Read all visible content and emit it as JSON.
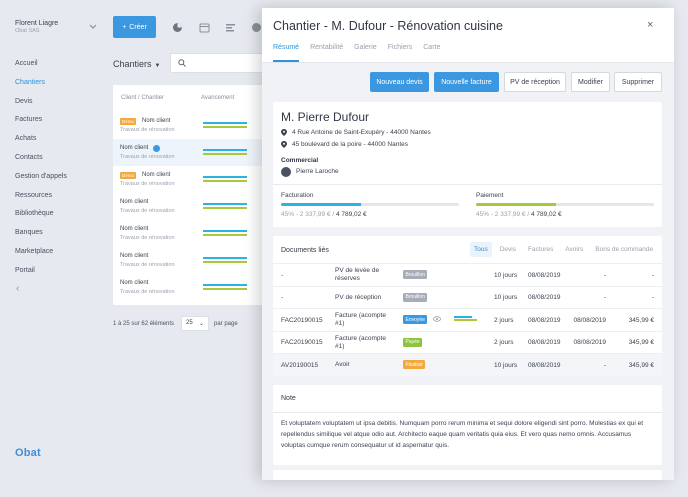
{
  "company": {
    "name": "Florent Liagre",
    "sub": "Obat SAS"
  },
  "toolbar": {
    "create_label": "Créer"
  },
  "sidebar": {
    "items": [
      {
        "label": "Accueil",
        "active": false
      },
      {
        "label": "Chantiers",
        "active": true
      },
      {
        "label": "Devis",
        "active": false
      },
      {
        "label": "Factures",
        "active": false
      },
      {
        "label": "Achats",
        "active": false
      },
      {
        "label": "Contacts",
        "active": false
      },
      {
        "label": "Gestion d'appels",
        "active": false
      },
      {
        "label": "Ressources",
        "active": false
      },
      {
        "label": "Bibliothèque",
        "active": false
      },
      {
        "label": "Banques",
        "active": false
      },
      {
        "label": "Marketplace",
        "active": false
      },
      {
        "label": "Portail",
        "active": false
      }
    ],
    "back_glyph": "‹",
    "logo": "Obat"
  },
  "list": {
    "title": "Chantiers",
    "columns": {
      "client": "Client / Chantier",
      "progress": "Avancement"
    },
    "rows": [
      {
        "badge": "Démo",
        "name": "Nom client",
        "sub": "Travaux de rénovation"
      },
      {
        "badge": "",
        "name": "Nom client",
        "sub": "Travaux de rénovation"
      },
      {
        "badge": "Démo",
        "name": "Nom client",
        "sub": "Travaux de rénovation"
      },
      {
        "badge": "",
        "name": "Nom client",
        "sub": "Travaux de rénovation"
      },
      {
        "badge": "",
        "name": "Nom client",
        "sub": "Travaux de rénovation"
      },
      {
        "badge": "",
        "name": "Nom client",
        "sub": "Travaux de rénovation"
      },
      {
        "badge": "",
        "name": "Nom client",
        "sub": "Travaux de rénovation"
      }
    ],
    "pager_text": "1 à 25 sur 62 éléments",
    "page_size": "25",
    "page_size_suffix": "par page"
  },
  "drawer": {
    "title": "Chantier - M. Dufour - Rénovation cuisine",
    "close_glyph": "×",
    "tabs": [
      {
        "label": "Résumé",
        "active": true
      },
      {
        "label": "Rentabilité",
        "active": false
      },
      {
        "label": "Galerie",
        "active": false
      },
      {
        "label": "Fichiers",
        "active": false
      },
      {
        "label": "Carte",
        "active": false
      }
    ],
    "actions": {
      "new_quote": "Nouveau devis",
      "new_invoice": "Nouvelle facture",
      "pv": "PV de réception",
      "edit": "Modifier",
      "delete": "Supprimer"
    },
    "client": {
      "name": "M. Pierre Dufour",
      "address1": "4 Rue Antoine de Saint-Exupéry - 44000 Nantes",
      "address2": "45 boulevard de la poire - 44000 Nantes",
      "commercial_label": "Commercial",
      "commercial_name": "Pierre Laroche"
    },
    "billing": {
      "label": "Facturation",
      "percent": 45,
      "percent_text": "45%",
      "amount": "2 337,99 €",
      "total": "4 789,02 €",
      "color": "#2db3e3"
    },
    "payment": {
      "label": "Paiement",
      "percent": 45,
      "percent_text": "45%",
      "amount": "2 337,99 €",
      "total": "4 789,02 €",
      "color": "#a8c93c"
    },
    "documents": {
      "title": "Documents liés",
      "filters": [
        {
          "label": "Tous",
          "active": true
        },
        {
          "label": "Devis",
          "active": false
        },
        {
          "label": "Factures",
          "active": false
        },
        {
          "label": "Avoirs",
          "active": false
        },
        {
          "label": "Bons de commande",
          "active": false
        }
      ],
      "rows": [
        {
          "ref": "-",
          "type": "PV de levée de réserves",
          "status": "Brouillon",
          "status_color": "#a7adb7",
          "delay": "10 jours",
          "date": "08/08/2019",
          "date2": "-",
          "amount": "-",
          "eye": false,
          "bars": false,
          "highlight": false
        },
        {
          "ref": "-",
          "type": "PV de réception",
          "status": "Brouillon",
          "status_color": "#a7adb7",
          "delay": "10 jours",
          "date": "08/08/2019",
          "date2": "-",
          "amount": "-",
          "eye": false,
          "bars": false,
          "highlight": false
        },
        {
          "ref": "FAC20190015",
          "type": "Facture (acompte #1)",
          "status": "Envoyée",
          "status_color": "#3b98e0",
          "delay": "2 jours",
          "date": "08/08/2019",
          "date2": "08/08/2019",
          "amount": "345,99 €",
          "eye": true,
          "bars": true,
          "highlight": false
        },
        {
          "ref": "FAC20190015",
          "type": "Facture (acompte #1)",
          "status": "Payée",
          "status_color": "#8cc43f",
          "delay": "2 jours",
          "date": "08/08/2019",
          "date2": "08/08/2019",
          "amount": "345,99 €",
          "eye": false,
          "bars": false,
          "highlight": false
        },
        {
          "ref": "AV20190015",
          "type": "Avoir",
          "status": "Finalisé",
          "status_color": "#f3a93b",
          "delay": "10 jours",
          "date": "08/08/2019",
          "date2": "-",
          "amount": "345,99 €",
          "eye": false,
          "bars": false,
          "highlight": true
        }
      ]
    },
    "note": {
      "title": "Note",
      "text": "Et voluptatem voluptatem ut ipsa debitis. Numquam porro rerum minima et sequi dolore eligendi sint porro. Molestias ex qui et repellendus similique vel atque odio aut. Architecto eaque quam veritatis quia eius. Et vero quas nemo omnis. Accusamus voluptas cumque rerum consequatur ut id aspernatur quis."
    }
  }
}
